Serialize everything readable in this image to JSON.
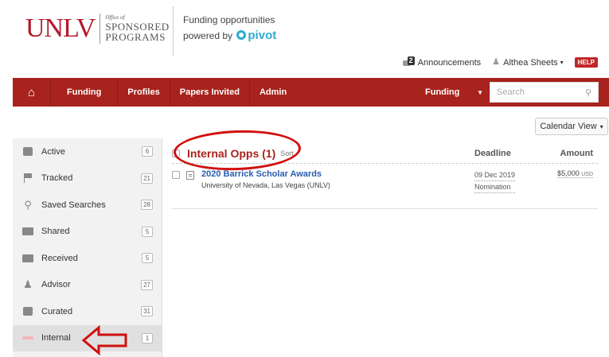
{
  "header": {
    "logo_text": "UNLV",
    "logo_osp_line1": "Office of",
    "logo_osp_line2": "SPONSORED",
    "logo_osp_line3": "PROGRAMS",
    "brand_line1": "Funding opportunities",
    "brand_line2_prefix": "powered by",
    "brand_pivot": "pivot"
  },
  "utility": {
    "announcements_count": "2",
    "announcements_label": "Announcements",
    "user_name": "Althea Sheets",
    "help_label": "HELP"
  },
  "nav": {
    "home_icon": "home-icon",
    "items": [
      {
        "label": "Funding"
      },
      {
        "label": "Profiles"
      },
      {
        "label": "Papers Invited"
      },
      {
        "label": "Admin"
      }
    ],
    "search_scope": "Funding",
    "search_placeholder": "Search"
  },
  "calendar_view_label": "Calendar View",
  "sidebar": {
    "items": [
      {
        "label": "Active",
        "count": "6",
        "icon": "active-icon"
      },
      {
        "label": "Tracked",
        "count": "21",
        "icon": "flag-icon"
      },
      {
        "label": "Saved Searches",
        "count": "28",
        "icon": "search-icon"
      },
      {
        "label": "Shared",
        "count": "5",
        "icon": "shared-icon"
      },
      {
        "label": "Received",
        "count": "5",
        "icon": "received-icon"
      },
      {
        "label": "Advisor",
        "count": "27",
        "icon": "advisor-icon"
      },
      {
        "label": "Curated",
        "count": "31",
        "icon": "curated-icon"
      },
      {
        "label": "Internal",
        "count": "1",
        "icon": "internal-icon"
      }
    ]
  },
  "main": {
    "folder_title": "Internal Opps",
    "folder_count": "(1)",
    "sort_label": "Sort",
    "col_deadline": "Deadline",
    "col_amount": "Amount",
    "results": [
      {
        "title": "2020 Barrick Scholar Awards",
        "sponsor": "University of Nevada, Las Vegas (UNLV)",
        "deadline_date": "09 Dec 2019",
        "deadline_type": "Nomination",
        "amount": "$5,000",
        "currency": "USD"
      }
    ]
  },
  "colors": {
    "nav_bg": "#a8231d",
    "folder_title": "#a8231d",
    "link": "#2a5db0",
    "annotation": "#d10f0f"
  }
}
